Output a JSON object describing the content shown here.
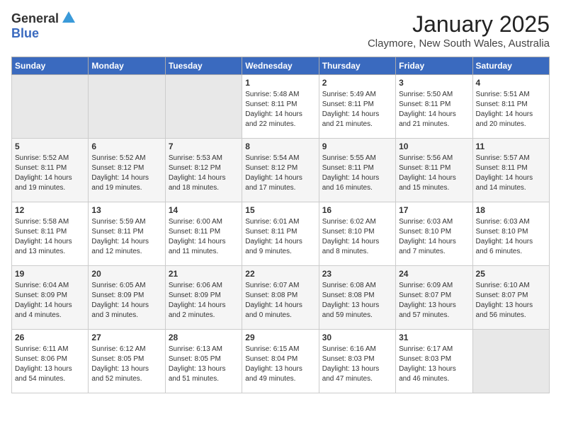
{
  "header": {
    "logo_general": "General",
    "logo_blue": "Blue",
    "month": "January 2025",
    "location": "Claymore, New South Wales, Australia"
  },
  "weekdays": [
    "Sunday",
    "Monday",
    "Tuesday",
    "Wednesday",
    "Thursday",
    "Friday",
    "Saturday"
  ],
  "weeks": [
    [
      {
        "day": "",
        "sunrise": "",
        "sunset": "",
        "daylight": ""
      },
      {
        "day": "",
        "sunrise": "",
        "sunset": "",
        "daylight": ""
      },
      {
        "day": "",
        "sunrise": "",
        "sunset": "",
        "daylight": ""
      },
      {
        "day": "1",
        "sunrise": "Sunrise: 5:48 AM",
        "sunset": "Sunset: 8:11 PM",
        "daylight": "Daylight: 14 hours and 22 minutes."
      },
      {
        "day": "2",
        "sunrise": "Sunrise: 5:49 AM",
        "sunset": "Sunset: 8:11 PM",
        "daylight": "Daylight: 14 hours and 21 minutes."
      },
      {
        "day": "3",
        "sunrise": "Sunrise: 5:50 AM",
        "sunset": "Sunset: 8:11 PM",
        "daylight": "Daylight: 14 hours and 21 minutes."
      },
      {
        "day": "4",
        "sunrise": "Sunrise: 5:51 AM",
        "sunset": "Sunset: 8:11 PM",
        "daylight": "Daylight: 14 hours and 20 minutes."
      }
    ],
    [
      {
        "day": "5",
        "sunrise": "Sunrise: 5:52 AM",
        "sunset": "Sunset: 8:11 PM",
        "daylight": "Daylight: 14 hours and 19 minutes."
      },
      {
        "day": "6",
        "sunrise": "Sunrise: 5:52 AM",
        "sunset": "Sunset: 8:12 PM",
        "daylight": "Daylight: 14 hours and 19 minutes."
      },
      {
        "day": "7",
        "sunrise": "Sunrise: 5:53 AM",
        "sunset": "Sunset: 8:12 PM",
        "daylight": "Daylight: 14 hours and 18 minutes."
      },
      {
        "day": "8",
        "sunrise": "Sunrise: 5:54 AM",
        "sunset": "Sunset: 8:12 PM",
        "daylight": "Daylight: 14 hours and 17 minutes."
      },
      {
        "day": "9",
        "sunrise": "Sunrise: 5:55 AM",
        "sunset": "Sunset: 8:11 PM",
        "daylight": "Daylight: 14 hours and 16 minutes."
      },
      {
        "day": "10",
        "sunrise": "Sunrise: 5:56 AM",
        "sunset": "Sunset: 8:11 PM",
        "daylight": "Daylight: 14 hours and 15 minutes."
      },
      {
        "day": "11",
        "sunrise": "Sunrise: 5:57 AM",
        "sunset": "Sunset: 8:11 PM",
        "daylight": "Daylight: 14 hours and 14 minutes."
      }
    ],
    [
      {
        "day": "12",
        "sunrise": "Sunrise: 5:58 AM",
        "sunset": "Sunset: 8:11 PM",
        "daylight": "Daylight: 14 hours and 13 minutes."
      },
      {
        "day": "13",
        "sunrise": "Sunrise: 5:59 AM",
        "sunset": "Sunset: 8:11 PM",
        "daylight": "Daylight: 14 hours and 12 minutes."
      },
      {
        "day": "14",
        "sunrise": "Sunrise: 6:00 AM",
        "sunset": "Sunset: 8:11 PM",
        "daylight": "Daylight: 14 hours and 11 minutes."
      },
      {
        "day": "15",
        "sunrise": "Sunrise: 6:01 AM",
        "sunset": "Sunset: 8:11 PM",
        "daylight": "Daylight: 14 hours and 9 minutes."
      },
      {
        "day": "16",
        "sunrise": "Sunrise: 6:02 AM",
        "sunset": "Sunset: 8:10 PM",
        "daylight": "Daylight: 14 hours and 8 minutes."
      },
      {
        "day": "17",
        "sunrise": "Sunrise: 6:03 AM",
        "sunset": "Sunset: 8:10 PM",
        "daylight": "Daylight: 14 hours and 7 minutes."
      },
      {
        "day": "18",
        "sunrise": "Sunrise: 6:03 AM",
        "sunset": "Sunset: 8:10 PM",
        "daylight": "Daylight: 14 hours and 6 minutes."
      }
    ],
    [
      {
        "day": "19",
        "sunrise": "Sunrise: 6:04 AM",
        "sunset": "Sunset: 8:09 PM",
        "daylight": "Daylight: 14 hours and 4 minutes."
      },
      {
        "day": "20",
        "sunrise": "Sunrise: 6:05 AM",
        "sunset": "Sunset: 8:09 PM",
        "daylight": "Daylight: 14 hours and 3 minutes."
      },
      {
        "day": "21",
        "sunrise": "Sunrise: 6:06 AM",
        "sunset": "Sunset: 8:09 PM",
        "daylight": "Daylight: 14 hours and 2 minutes."
      },
      {
        "day": "22",
        "sunrise": "Sunrise: 6:07 AM",
        "sunset": "Sunset: 8:08 PM",
        "daylight": "Daylight: 14 hours and 0 minutes."
      },
      {
        "day": "23",
        "sunrise": "Sunrise: 6:08 AM",
        "sunset": "Sunset: 8:08 PM",
        "daylight": "Daylight: 13 hours and 59 minutes."
      },
      {
        "day": "24",
        "sunrise": "Sunrise: 6:09 AM",
        "sunset": "Sunset: 8:07 PM",
        "daylight": "Daylight: 13 hours and 57 minutes."
      },
      {
        "day": "25",
        "sunrise": "Sunrise: 6:10 AM",
        "sunset": "Sunset: 8:07 PM",
        "daylight": "Daylight: 13 hours and 56 minutes."
      }
    ],
    [
      {
        "day": "26",
        "sunrise": "Sunrise: 6:11 AM",
        "sunset": "Sunset: 8:06 PM",
        "daylight": "Daylight: 13 hours and 54 minutes."
      },
      {
        "day": "27",
        "sunrise": "Sunrise: 6:12 AM",
        "sunset": "Sunset: 8:05 PM",
        "daylight": "Daylight: 13 hours and 52 minutes."
      },
      {
        "day": "28",
        "sunrise": "Sunrise: 6:13 AM",
        "sunset": "Sunset: 8:05 PM",
        "daylight": "Daylight: 13 hours and 51 minutes."
      },
      {
        "day": "29",
        "sunrise": "Sunrise: 6:15 AM",
        "sunset": "Sunset: 8:04 PM",
        "daylight": "Daylight: 13 hours and 49 minutes."
      },
      {
        "day": "30",
        "sunrise": "Sunrise: 6:16 AM",
        "sunset": "Sunset: 8:03 PM",
        "daylight": "Daylight: 13 hours and 47 minutes."
      },
      {
        "day": "31",
        "sunrise": "Sunrise: 6:17 AM",
        "sunset": "Sunset: 8:03 PM",
        "daylight": "Daylight: 13 hours and 46 minutes."
      },
      {
        "day": "",
        "sunrise": "",
        "sunset": "",
        "daylight": ""
      }
    ]
  ]
}
